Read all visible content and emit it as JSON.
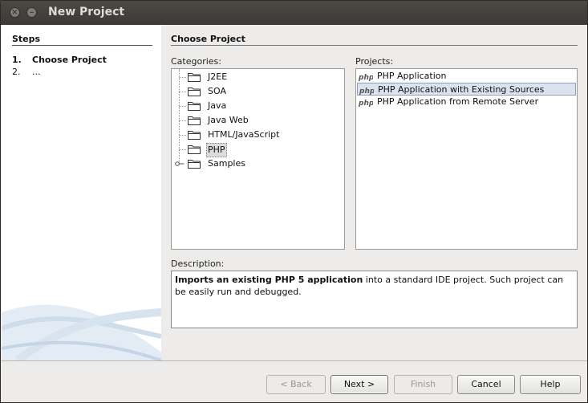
{
  "window": {
    "title": "New Project"
  },
  "steps": {
    "title": "Steps",
    "items": [
      {
        "num": "1.",
        "label": "Choose Project"
      },
      {
        "num": "2.",
        "label": "..."
      }
    ]
  },
  "main": {
    "title": "Choose Project",
    "categories_label": "Categories:",
    "projects_label": "Projects:",
    "description_label": "Description:",
    "categories": [
      "J2EE",
      "SOA",
      "Java",
      "Java Web",
      "HTML/JavaScript",
      "PHP",
      "Samples"
    ],
    "selected_category": "PHP",
    "projects": [
      "PHP Application",
      "PHP Application with Existing Sources",
      "PHP Application from Remote Server"
    ],
    "selected_project": "PHP Application with Existing Sources",
    "description_bold": "Imports an existing PHP 5 application",
    "description_rest": " into a standard IDE project. Such project can be easily run and debugged."
  },
  "buttons": {
    "back": "< Back",
    "next": "Next >",
    "finish": "Finish",
    "cancel": "Cancel",
    "help": "Help"
  },
  "colors": {
    "selection": "#dce3ee",
    "titlebar": "#3b3a36"
  }
}
